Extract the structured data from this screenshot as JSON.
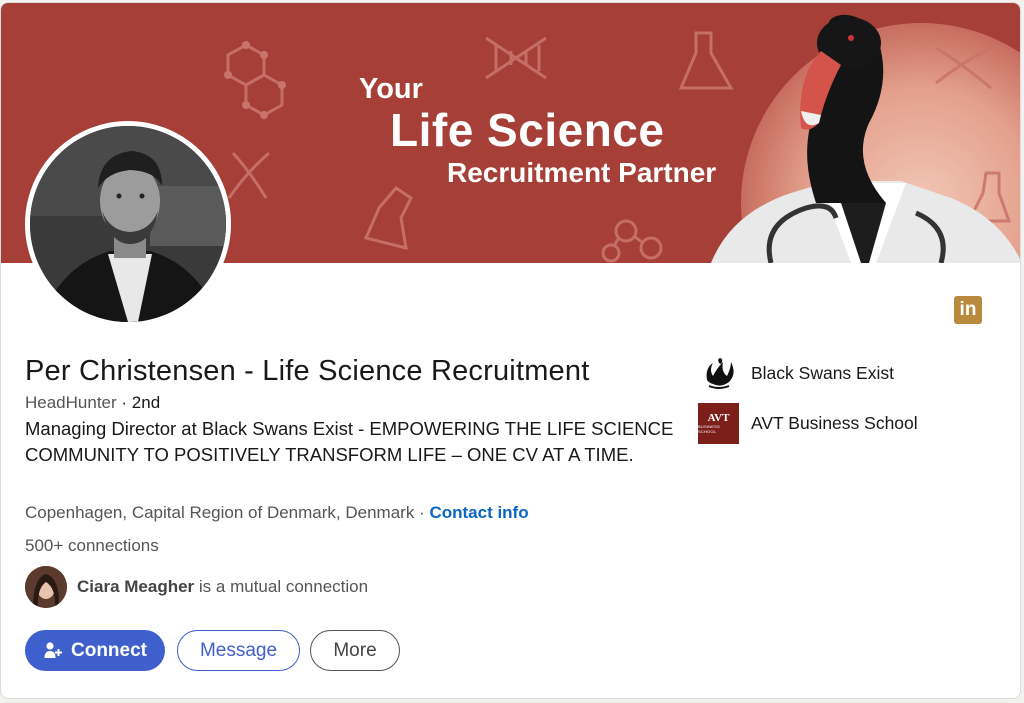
{
  "banner": {
    "line1": "Your",
    "line2": "Life Science",
    "line3": "Recruitment Partner"
  },
  "profile": {
    "name": "Per Christensen - Life Science Recruitment",
    "role": "HeadHunter",
    "degree": "· 2nd",
    "headline": "Managing Director at Black Swans Exist - EMPOWERING THE LIFE SCIENCE COMMUNITY TO POSITIVELY TRANSFORM LIFE – ONE CV AT A TIME.",
    "location": "Copenhagen, Capital Region of Denmark, Denmark ·",
    "contact_info": "Contact info",
    "connections": "500+ connections",
    "mutual_name": "Ciara Meagher",
    "mutual_suffix": "is a mutual connection"
  },
  "actions": {
    "connect": "Connect",
    "message": "Message",
    "more": "More"
  },
  "organizations": [
    {
      "name": "Black Swans Exist",
      "icon": "black-swan-logo"
    },
    {
      "name": "AVT Business School",
      "icon": "avt-logo",
      "logo_text": "AVT",
      "logo_subtext": "BUSINESS SCHOOL"
    }
  ],
  "linkedin_badge": "in",
  "colors": {
    "banner": "#a53f37",
    "primary": "#3f60cc",
    "link": "#0a66c2",
    "badge": "#b98a3e"
  }
}
